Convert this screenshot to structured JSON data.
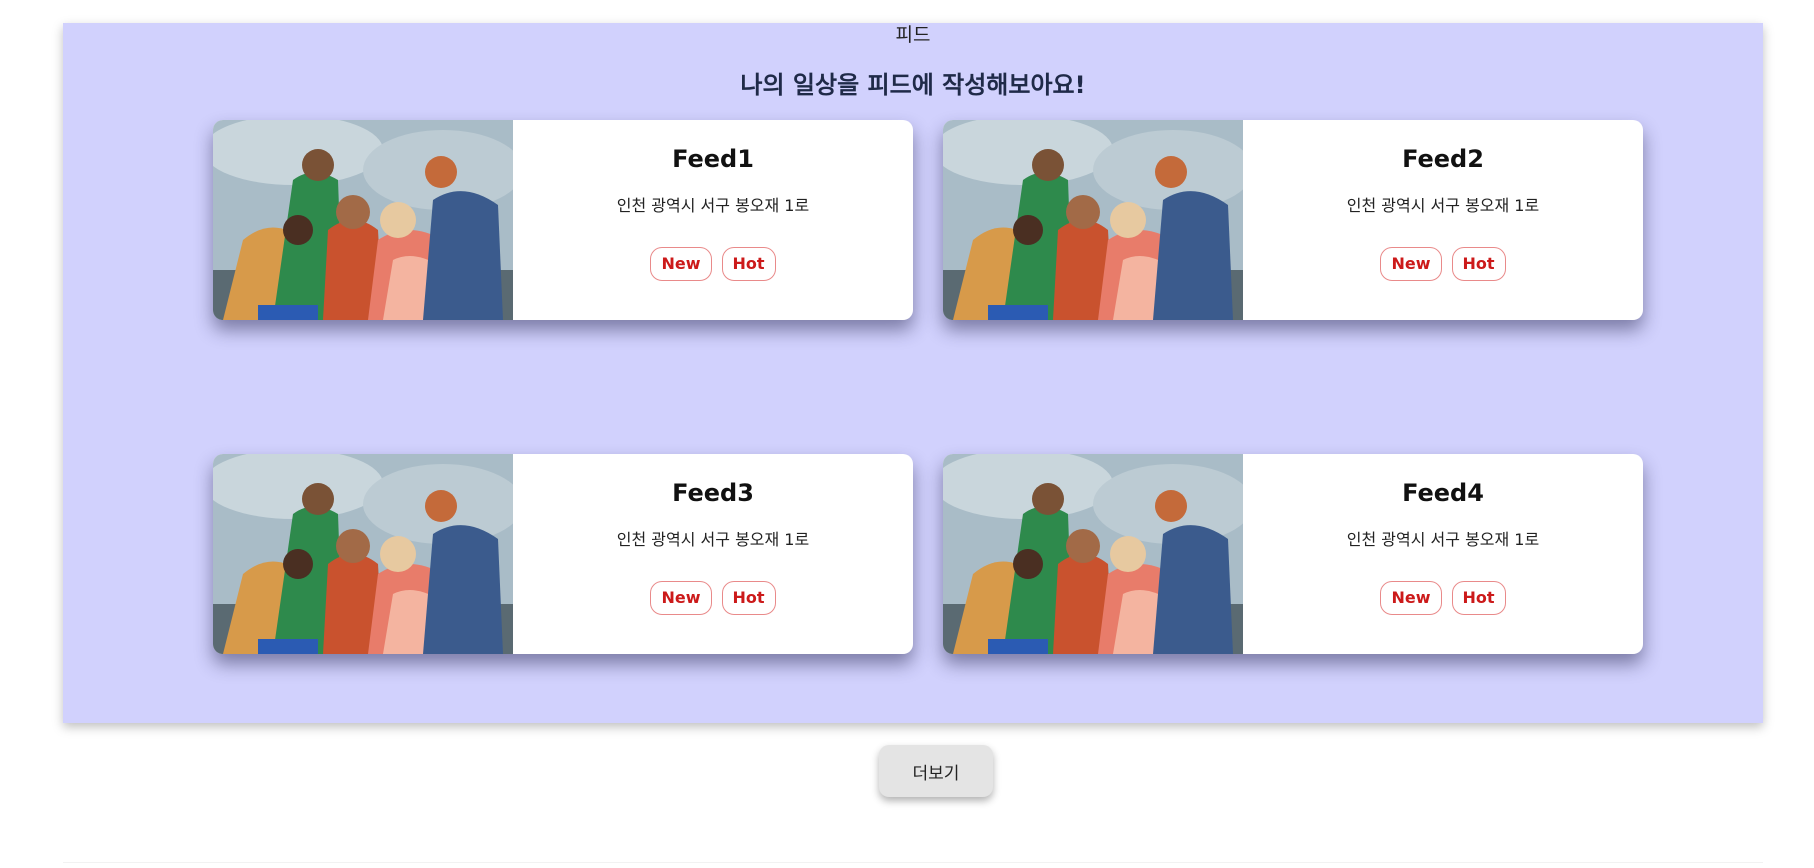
{
  "section": {
    "label": "피드",
    "heading": "나의 일상을 피드에 작성해보아요!",
    "background": "#d1d1fd"
  },
  "feeds": [
    {
      "title": "Feed1",
      "address": "인천 광역시 서구 봉오재 1로",
      "badges": [
        "New",
        "Hot"
      ]
    },
    {
      "title": "Feed2",
      "address": "인천 광역시 서구 봉오재 1로",
      "badges": [
        "New",
        "Hot"
      ]
    },
    {
      "title": "Feed3",
      "address": "인천 광역시 서구 봉오재 1로",
      "badges": [
        "New",
        "Hot"
      ]
    },
    {
      "title": "Feed4",
      "address": "인천 광역시 서구 봉오재 1로",
      "badges": [
        "New",
        "Hot"
      ]
    }
  ],
  "more_button": {
    "label": "더보기"
  },
  "colors": {
    "badge_text": "#cc1a1a",
    "badge_border": "#e98a8a"
  }
}
